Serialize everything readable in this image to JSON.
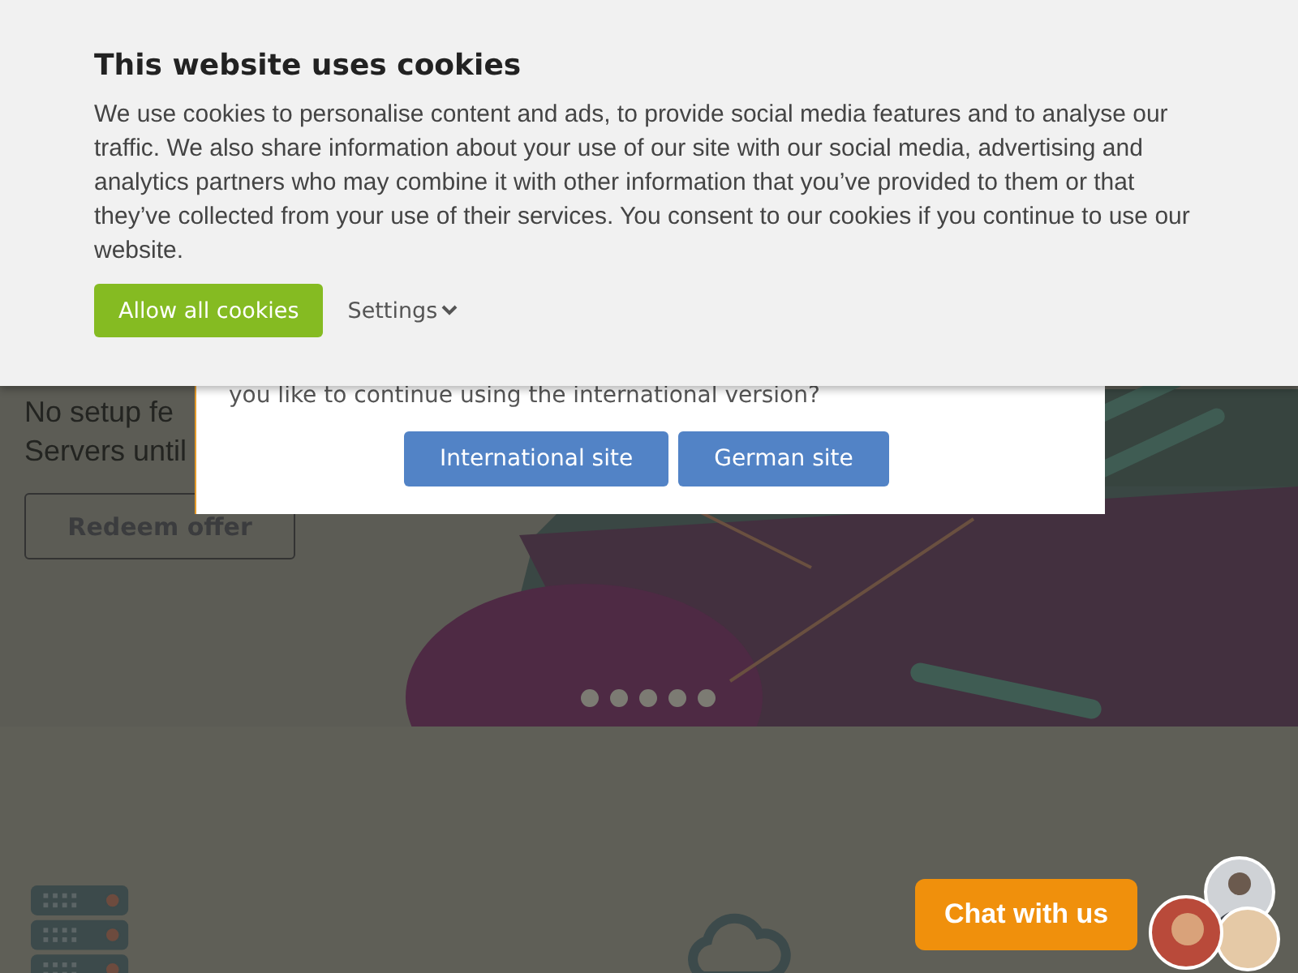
{
  "cookie_banner": {
    "title": "This website uses cookies",
    "text": "We use cookies to personalise content and ads, to provide social media features and to analyse our traffic. We also share information about your use of our site with our social media, advertising and analytics partners who may combine it with other information that you’ve provided to them or that they’ve collected from your use of their services. You consent to our cookies if you continue to use our website.",
    "buttons": [
      {
        "label": "Allow all cookies",
        "kind": "primary"
      },
      {
        "label": "Settings",
        "kind": "dropdown"
      }
    ]
  },
  "dialog": {
    "text": "you like to continue using the international version?",
    "buttons": [
      "International site",
      "German site"
    ]
  },
  "hero": {
    "lines": [
      "No setup fe",
      "Servers until"
    ],
    "button": "Redeem offer"
  },
  "chat": {
    "label": "Chat with us"
  }
}
